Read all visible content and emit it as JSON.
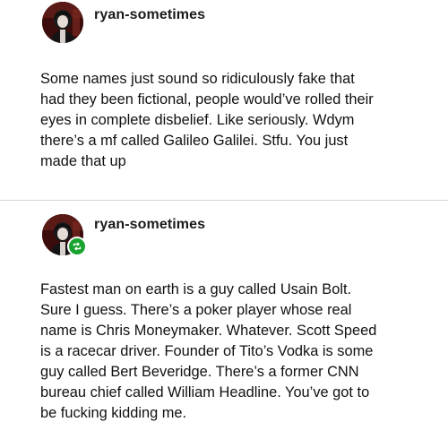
{
  "posts": [
    {
      "username": "ryan-sometimes",
      "reblogged": false,
      "body": "Some names just sound so ridiculously fake that\nhad they been fictional, people would’ve rolled their\neyes in complete disbelief. Like seriously. Wdym\nthere’s a mf called Galileo Galilei. Stfu. You just\nmade that up"
    },
    {
      "username": "ryan-sometimes",
      "reblogged": true,
      "body": "Fastest man on earth is a guy called Usain Bolt.\nSure I guess. There’s a poker player whose real\nname is Chris Moneymaker. Whatever. Scott Speed\nis a racecar driver. Founder of Tito’s Vodka is some\nguy called Bert Beveridge. There’s a former CNN\nbureau chief called William Headline. You’ve got to\nbe fucking kidding me."
    }
  ],
  "colors": {
    "reblog_badge": "#17a32e",
    "divider": "#d6d6d6",
    "text": "#111111",
    "avatar_bg": "#3a0d0c"
  },
  "icons": {
    "avatar": "avatar-icon",
    "reblog": "reblog-icon"
  }
}
